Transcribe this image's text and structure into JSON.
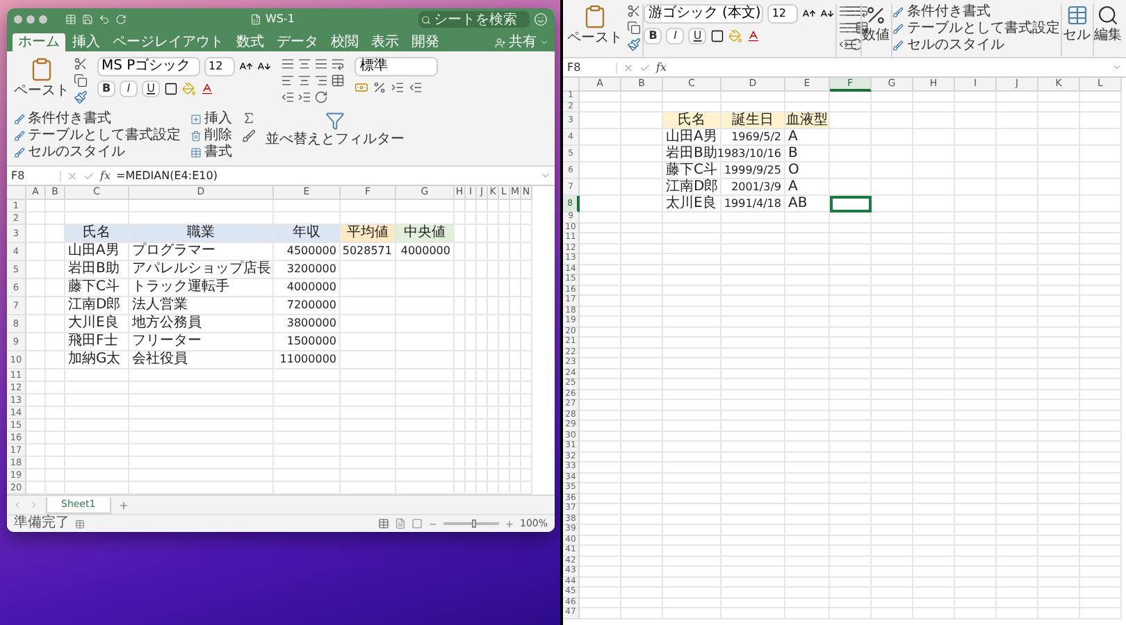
{
  "left_window": {
    "title": "WS-1",
    "search": {
      "placeholder": "シートを検索"
    },
    "tabs": [
      {
        "label": "ホーム",
        "selected": true
      },
      {
        "label": "挿入",
        "selected": false
      },
      {
        "label": "ページレイアウト",
        "selected": false
      },
      {
        "label": "数式",
        "selected": false
      },
      {
        "label": "データ",
        "selected": false
      },
      {
        "label": "校閲",
        "selected": false
      },
      {
        "label": "表示",
        "selected": false
      },
      {
        "label": "開発",
        "selected": false
      }
    ],
    "share": "共有",
    "ribbon": {
      "paste": "ペースト",
      "font_name": "MS Pゴシック",
      "font_size": "12",
      "format_buttons": [
        "B",
        "I",
        "U"
      ],
      "number_format": "標準",
      "styles": [
        "条件付き書式",
        "テーブルとして書式設定",
        "セルのスタイル"
      ],
      "cells": [
        "挿入",
        "削除",
        "書式"
      ],
      "sort_filter": "並べ替えとフィルター"
    },
    "formula_bar": {
      "name_box": "F8",
      "fx": "fx",
      "formula": "=MEDIAN(E4:E10)"
    },
    "sheet": {
      "columns": [
        {
          "label": "A",
          "selected": false
        },
        {
          "label": "B",
          "selected": false
        },
        {
          "label": "C",
          "selected": false
        },
        {
          "label": "D",
          "selected": false
        },
        {
          "label": "E",
          "selected": false
        },
        {
          "label": "F",
          "selected": false
        },
        {
          "label": "G",
          "selected": false
        },
        {
          "label": "H",
          "selected": false
        },
        {
          "label": "I",
          "selected": false
        },
        {
          "label": "J",
          "selected": false
        },
        {
          "label": "K",
          "selected": false
        },
        {
          "label": "L",
          "selected": false
        },
        {
          "label": "M",
          "selected": false
        },
        {
          "label": "N",
          "selected": false
        }
      ],
      "rows": [
        {
          "label": "1",
          "selected": false
        },
        {
          "label": "2",
          "selected": false
        },
        {
          "label": "3",
          "selected": false,
          "cells": [
            {
              "kind": "header",
              "text": "氏名",
              "color": "#dce6f2",
              "selected": false
            },
            {
              "kind": "header",
              "text": "職業",
              "color": "#dce6f2",
              "selected": false
            },
            {
              "kind": "header",
              "text": "年収",
              "color": "#dce6f2",
              "selected": false
            },
            {
              "kind": "header",
              "text": "平均値",
              "color": "#fde9c4",
              "selected": false
            },
            {
              "kind": "header",
              "text": "中央値",
              "color": "#e2efda",
              "selected": false
            }
          ]
        },
        {
          "label": "4",
          "selected": false,
          "cells": [
            {
              "kind": "text",
              "text": "山田A男",
              "selected": false
            },
            {
              "kind": "text",
              "text": "プログラマー",
              "selected": false
            },
            {
              "kind": "number",
              "text": "4500000",
              "selected": false
            },
            {
              "kind": "number",
              "text": "5028571",
              "selected": false
            },
            {
              "kind": "number",
              "text": "4000000",
              "selected": false
            }
          ]
        },
        {
          "label": "5",
          "selected": false,
          "cells": [
            {
              "kind": "text",
              "text": "岩田B助",
              "selected": false
            },
            {
              "kind": "text",
              "text": "アパレルショップ店長",
              "selected": false
            },
            {
              "kind": "number",
              "text": "3200000",
              "selected": false
            }
          ]
        },
        {
          "label": "6",
          "selected": false,
          "cells": [
            {
              "kind": "text",
              "text": "藤下C斗",
              "selected": false
            },
            {
              "kind": "text",
              "text": "トラック運転手",
              "selected": false
            },
            {
              "kind": "number",
              "text": "4000000",
              "selected": false
            }
          ]
        },
        {
          "label": "7",
          "selected": false,
          "cells": [
            {
              "kind": "text",
              "text": "江南D郎",
              "selected": false
            },
            {
              "kind": "text",
              "text": "法人営業",
              "selected": false
            },
            {
              "kind": "number",
              "text": "7200000",
              "selected": false
            }
          ]
        },
        {
          "label": "8",
          "selected": false,
          "cells": [
            {
              "kind": "text",
              "text": "大川E良",
              "selected": false
            },
            {
              "kind": "text",
              "text": "地方公務員",
              "selected": false
            },
            {
              "kind": "number",
              "text": "3800000",
              "selected": false
            }
          ]
        },
        {
          "label": "9",
          "selected": false,
          "cells": [
            {
              "kind": "text",
              "text": "飛田F士",
              "selected": false
            },
            {
              "kind": "text",
              "text": "フリーター",
              "selected": false
            },
            {
              "kind": "number",
              "text": "1500000",
              "selected": false
            }
          ]
        },
        {
          "label": "10",
          "selected": false,
          "cells": [
            {
              "kind": "text",
              "text": "加納G太",
              "selected": false
            },
            {
              "kind": "text",
              "text": "会社役員",
              "selected": false
            },
            {
              "kind": "number",
              "text": "11000000",
              "selected": false
            }
          ]
        },
        {
          "label": "11",
          "selected": false
        },
        {
          "label": "12",
          "selected": false
        },
        {
          "label": "13",
          "selected": false
        },
        {
          "label": "14",
          "selected": false
        },
        {
          "label": "15",
          "selected": false
        },
        {
          "label": "16",
          "selected": false
        },
        {
          "label": "17",
          "selected": false
        },
        {
          "label": "18",
          "selected": false
        },
        {
          "label": "19",
          "selected": false
        },
        {
          "label": "20",
          "selected": false
        }
      ]
    },
    "sheet_tabs": [
      {
        "label": "Sheet1",
        "selected": true
      }
    ],
    "status": "準備完了",
    "zoom": {
      "level": 0.55,
      "reading": "100%"
    }
  },
  "right_window": {
    "ribbon": {
      "paste": "ペースト",
      "font_name": "游ゴシック (本文)",
      "font_size": "12",
      "format_buttons": [
        "B",
        "I",
        "U"
      ],
      "number": "数値",
      "styles": [
        "条件付き書式",
        "テーブルとして書式設定",
        "セルのスタイル"
      ],
      "cells": "セル",
      "editing": "編集"
    },
    "formula_bar": {
      "name_box": "F8",
      "fx": "fx"
    },
    "sheet": {
      "columns": [
        {
          "label": "A",
          "selected": false
        },
        {
          "label": "B",
          "selected": false
        },
        {
          "label": "C",
          "selected": false
        },
        {
          "label": "D",
          "selected": false
        },
        {
          "label": "E",
          "selected": false
        },
        {
          "label": "F",
          "selected": true
        },
        {
          "label": "G",
          "selected": false
        },
        {
          "label": "H",
          "selected": false
        },
        {
          "label": "I",
          "selected": false
        },
        {
          "label": "J",
          "selected": false
        },
        {
          "label": "K",
          "selected": false
        },
        {
          "label": "L",
          "selected": false
        }
      ],
      "rows": [
        {
          "label": "1",
          "selected": false
        },
        {
          "label": "2",
          "selected": false
        },
        {
          "label": "3",
          "selected": false,
          "cells": [
            {
              "kind": "header",
              "text": "氏名",
              "color": "#fff2cc",
              "selected": false
            },
            {
              "kind": "header",
              "text": "誕生日",
              "color": "#fff2cc",
              "selected": false
            },
            {
              "kind": "header",
              "text": "血液型",
              "color": "#fff2cc",
              "selected": false
            }
          ]
        },
        {
          "label": "4",
          "selected": false,
          "cells": [
            {
              "kind": "text",
              "text": "山田A男",
              "selected": false
            },
            {
              "kind": "number",
              "text": "1969/5/2",
              "selected": false
            },
            {
              "kind": "text",
              "text": "A",
              "selected": false
            }
          ]
        },
        {
          "label": "5",
          "selected": false,
          "cells": [
            {
              "kind": "text",
              "text": "岩田B助",
              "selected": false
            },
            {
              "kind": "number",
              "text": "1983/10/16",
              "selected": false
            },
            {
              "kind": "text",
              "text": "B",
              "selected": false
            }
          ]
        },
        {
          "label": "6",
          "selected": false,
          "cells": [
            {
              "kind": "text",
              "text": "藤下C斗",
              "selected": false
            },
            {
              "kind": "number",
              "text": "1999/9/25",
              "selected": false
            },
            {
              "kind": "text",
              "text": "O",
              "selected": false
            }
          ]
        },
        {
          "label": "7",
          "selected": false,
          "cells": [
            {
              "kind": "text",
              "text": "江南D郎",
              "selected": false
            },
            {
              "kind": "number",
              "text": "2001/3/9",
              "selected": false
            },
            {
              "kind": "text",
              "text": "A",
              "selected": false
            }
          ]
        },
        {
          "label": "8",
          "selected": true,
          "cells": [
            {
              "kind": "text",
              "text": "太川E良",
              "selected": false
            },
            {
              "kind": "number",
              "text": "1991/4/18",
              "selected": false
            },
            {
              "kind": "text",
              "text": "AB",
              "selected": false
            },
            {
              "kind": "empty",
              "selected": true
            }
          ]
        },
        {
          "label": "9",
          "selected": false
        },
        {
          "label": "10",
          "selected": false
        },
        {
          "label": "11",
          "selected": false
        },
        {
          "label": "12",
          "selected": false
        },
        {
          "label": "13",
          "selected": false
        },
        {
          "label": "14",
          "selected": false
        },
        {
          "label": "15",
          "selected": false
        },
        {
          "label": "16",
          "selected": false
        },
        {
          "label": "17",
          "selected": false
        },
        {
          "label": "18",
          "selected": false
        },
        {
          "label": "19",
          "selected": false
        },
        {
          "label": "20",
          "selected": false
        },
        {
          "label": "21",
          "selected": false
        },
        {
          "label": "22",
          "selected": false
        },
        {
          "label": "23",
          "selected": false
        },
        {
          "label": "24",
          "selected": false
        },
        {
          "label": "25",
          "selected": false
        },
        {
          "label": "26",
          "selected": false
        },
        {
          "label": "27",
          "selected": false
        },
        {
          "label": "28",
          "selected": false
        },
        {
          "label": "29",
          "selected": false
        },
        {
          "label": "30",
          "selected": false
        },
        {
          "label": "31",
          "selected": false
        },
        {
          "label": "32",
          "selected": false
        },
        {
          "label": "33",
          "selected": false
        },
        {
          "label": "34",
          "selected": false
        },
        {
          "label": "35",
          "selected": false
        },
        {
          "label": "36",
          "selected": false
        },
        {
          "label": "37",
          "selected": false
        },
        {
          "label": "38",
          "selected": false
        },
        {
          "label": "39",
          "selected": false
        },
        {
          "label": "40",
          "selected": false
        },
        {
          "label": "41",
          "selected": false
        },
        {
          "label": "42",
          "selected": false
        },
        {
          "label": "43",
          "selected": false
        },
        {
          "label": "44",
          "selected": false
        },
        {
          "label": "45",
          "selected": false
        },
        {
          "label": "46",
          "selected": false
        },
        {
          "label": "47",
          "selected": false
        }
      ]
    }
  }
}
